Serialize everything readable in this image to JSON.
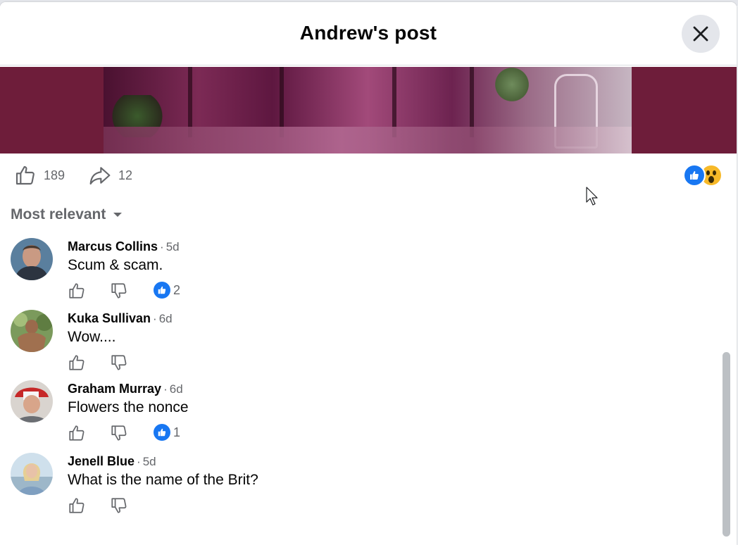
{
  "post": {
    "title": "Andrew's post"
  },
  "stats": {
    "likes": "189",
    "shares": "12"
  },
  "sort": {
    "label": "Most relevant"
  },
  "comments": [
    {
      "name": "Marcus Collins",
      "time": "5d",
      "text": "Scum & scam.",
      "reaction_count": "2"
    },
    {
      "name": "Kuka Sullivan",
      "time": "6d",
      "text": "Wow....",
      "reaction_count": ""
    },
    {
      "name": "Graham Murray",
      "time": "6d",
      "text": "Flowers the nonce",
      "reaction_count": "1"
    },
    {
      "name": "Jenell Blue",
      "time": "5d",
      "text": "What is the name of the Brit?",
      "reaction_count": ""
    }
  ],
  "icons": {
    "close": "close-icon",
    "like": "thumbs-up-icon",
    "dislike": "thumbs-down-icon",
    "share": "share-arrow-icon",
    "sort": "caret-down-icon",
    "cursor": "mouse-pointer-icon"
  },
  "colors": {
    "accent": "#1877f2",
    "wow": "#f7b928",
    "media_bg": "#6e1d3a",
    "muted": "#65676b"
  }
}
